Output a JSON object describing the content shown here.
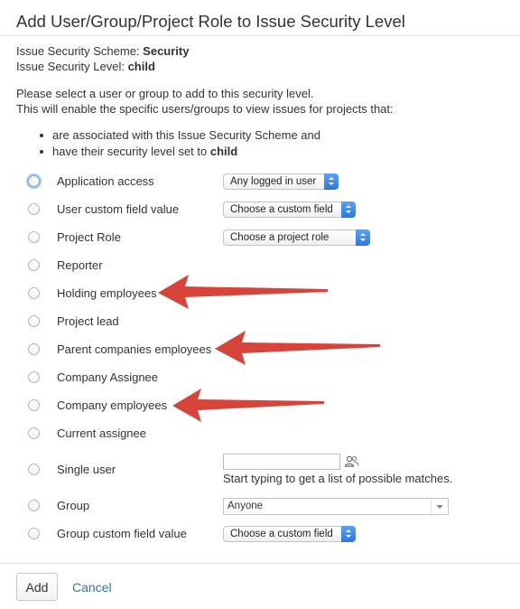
{
  "dialog": {
    "title": "Add User/Group/Project Role to Issue Security Level",
    "scheme_label": "Issue Security Scheme: ",
    "scheme_value": "Security",
    "level_label": "Issue Security Level: ",
    "level_value": "child",
    "instructions_1": "Please select a user or group to add to this security level.",
    "instructions_2": "This will enable the specific users/groups to view issues for projects that:",
    "bullet_1": "are associated with this Issue Security Scheme and",
    "bullet_2_prefix": "have their security level set to ",
    "bullet_2_value": "child"
  },
  "options": [
    {
      "label": "Application access",
      "select": "Any logged in user"
    },
    {
      "label": "User custom field value",
      "select": "Choose a custom field"
    },
    {
      "label": "Project Role",
      "select": "Choose a project role"
    },
    {
      "label": "Reporter"
    },
    {
      "label": "Holding employees"
    },
    {
      "label": "Project lead"
    },
    {
      "label": "Parent companies employees"
    },
    {
      "label": "Company Assignee"
    },
    {
      "label": "Company employees"
    },
    {
      "label": "Current assignee"
    },
    {
      "label": "Single user",
      "input_value": "",
      "hint": "Start typing to get a list of possible matches."
    },
    {
      "label": "Group",
      "select": "Anyone"
    },
    {
      "label": "Group custom field value",
      "select": "Choose a custom field"
    }
  ],
  "buttons": {
    "add": "Add",
    "cancel": "Cancel"
  },
  "colors": {
    "arrow": "#d8433a",
    "link": "#3572b0",
    "select_accent": "#3d8cf0"
  },
  "icons": {
    "user_picker": "users-icon",
    "dropdown": "chevron-updown-icon"
  }
}
